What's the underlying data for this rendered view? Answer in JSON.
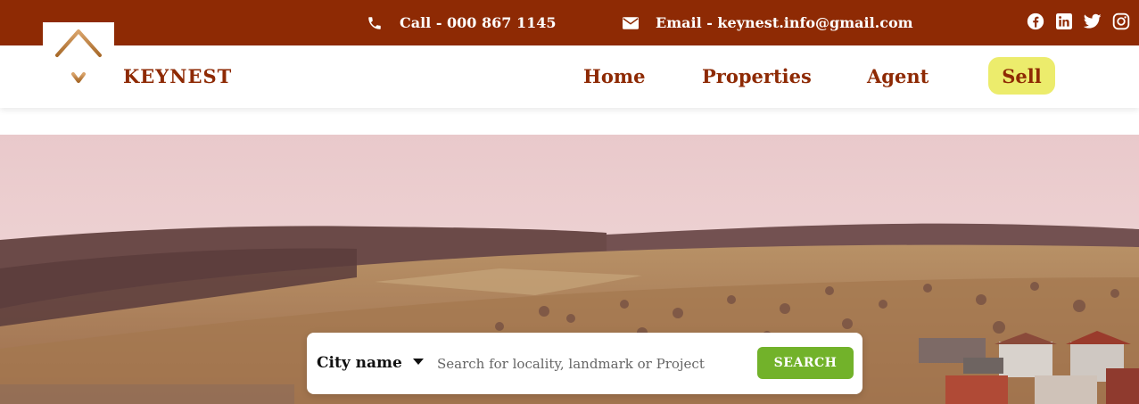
{
  "topbar": {
    "call": "Call - 000 867 1145",
    "email": "Email - keynest.info@gmail.com",
    "social": [
      "facebook-icon",
      "linkedin-icon",
      "twitter-icon",
      "instagram-icon"
    ],
    "bg_color": "#8e2a04"
  },
  "brand": {
    "name": "KEYNEST",
    "color": "#8e2a04"
  },
  "nav": {
    "items": [
      {
        "label": "Home"
      },
      {
        "label": "Properties"
      },
      {
        "label": "Agent"
      }
    ],
    "sell": "Sell"
  },
  "search": {
    "city_label": "City name",
    "placeholder": "Search for locality, landmark or Project",
    "button": "SEARCH"
  },
  "colors": {
    "accent": "#72b22a",
    "sell_bg": "#ecec6c"
  }
}
